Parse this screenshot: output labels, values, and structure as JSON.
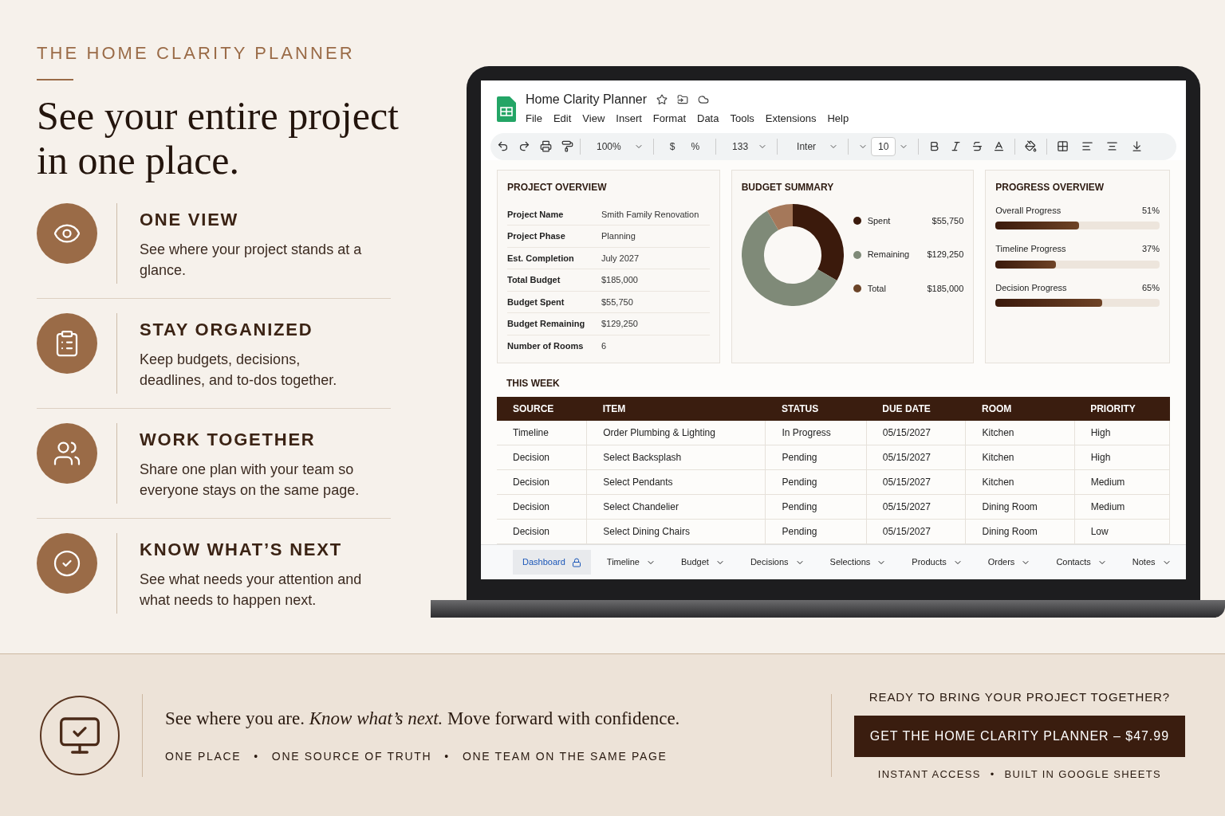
{
  "eyebrow": "THE HOME CLARITY PLANNER",
  "headline": "See your entire project in one place.",
  "features": [
    {
      "kind": "eye",
      "title": "ONE VIEW",
      "text": "See where your project stands at a glance."
    },
    {
      "kind": "clipboard",
      "title": "STAY ORGANIZED",
      "text": "Keep budgets, decisions, deadlines, and to-dos together."
    },
    {
      "kind": "users",
      "title": "WORK TOGETHER",
      "text": "Share one plan with your team so everyone stays on the same page."
    },
    {
      "kind": "check",
      "title": "KNOW WHAT’S NEXT",
      "text": "See what needs your attention and what needs to happen next."
    }
  ],
  "sheet": {
    "title": "Home Clarity Planner",
    "menu": [
      "File",
      "Edit",
      "View",
      "Insert",
      "Format",
      "Data",
      "Tools",
      "Extensions",
      "Help"
    ],
    "toolbar": {
      "zoom": "100%",
      "currency": "$",
      "percent": "%",
      "number_format": "133",
      "font": "Inter",
      "font_size": "10"
    },
    "project_overview": {
      "title": "PROJECT OVERVIEW",
      "rows": [
        {
          "label": "Project Name",
          "value": "Smith Family Renovation"
        },
        {
          "label": "Project Phase",
          "value": "Planning"
        },
        {
          "label": "Est. Completion",
          "value": "July 2027"
        },
        {
          "label": "Total Budget",
          "value": "$185,000"
        },
        {
          "label": "Budget Spent",
          "value": "$55,750"
        },
        {
          "label": "Budget Remaining",
          "value": "$129,250"
        },
        {
          "label": "Number of Rooms",
          "value": "6"
        }
      ]
    },
    "budget_summary": {
      "title": "BUDGET SUMMARY",
      "legend": [
        {
          "label": "Spent",
          "value": "$55,750",
          "color": "#3b1a0c"
        },
        {
          "label": "Remaining",
          "value": "$129,250",
          "color": "#7f8a78"
        },
        {
          "label": "Total",
          "value": "$185,000",
          "color": "#6b4428"
        }
      ]
    },
    "progress_overview": {
      "title": "PROGRESS OVERVIEW",
      "items": [
        {
          "label": "Overall Progress",
          "reading": "51%",
          "level": 0.51
        },
        {
          "label": "Timeline Progress",
          "reading": "37%",
          "level": 0.37
        },
        {
          "label": "Decision Progress",
          "reading": "65%",
          "level": 0.65
        }
      ]
    },
    "this_week": {
      "title": "THIS WEEK",
      "columns": [
        "SOURCE",
        "ITEM",
        "STATUS",
        "DUE DATE",
        "ROOM",
        "PRIORITY"
      ],
      "rows": [
        [
          "Timeline",
          "Order Plumbing & Lighting",
          "In Progress",
          "05/15/2027",
          "Kitchen",
          "High"
        ],
        [
          "Decision",
          "Select Backsplash",
          "Pending",
          "05/15/2027",
          "Kitchen",
          "High"
        ],
        [
          "Decision",
          "Select Pendants",
          "Pending",
          "05/15/2027",
          "Kitchen",
          "Medium"
        ],
        [
          "Decision",
          "Select Chandelier",
          "Pending",
          "05/15/2027",
          "Dining Room",
          "Medium"
        ],
        [
          "Decision",
          "Select Dining Chairs",
          "Pending",
          "05/15/2027",
          "Dining Room",
          "Low"
        ]
      ]
    },
    "sheet_tabs": [
      {
        "label": "Dashboard",
        "selected": true,
        "locked": true
      },
      {
        "label": "Timeline",
        "selected": false,
        "locked": false
      },
      {
        "label": "Budget",
        "selected": false,
        "locked": false
      },
      {
        "label": "Decisions",
        "selected": false,
        "locked": false
      },
      {
        "label": "Selections",
        "selected": false,
        "locked": false
      },
      {
        "label": "Products",
        "selected": false,
        "locked": false
      },
      {
        "label": "Orders",
        "selected": false,
        "locked": false
      },
      {
        "label": "Contacts",
        "selected": false,
        "locked": false
      },
      {
        "label": "Notes",
        "selected": false,
        "locked": false
      }
    ]
  },
  "footer": {
    "tagline": "See where you are. *Know what’s next.* Move forward with confidence.",
    "pillars": [
      "ONE PLACE",
      "ONE SOURCE OF TRUTH",
      "ONE TEAM ON THE SAME PAGE"
    ],
    "separator": "•",
    "cta_heading": "READY TO BRING YOUR PROJECT TOGETHER?",
    "cta_button": "GET THE HOME CLARITY PLANNER – $47.99",
    "cta_notes": [
      "INSTANT ACCESS",
      "BUILT IN GOOGLE SHEETS"
    ]
  }
}
